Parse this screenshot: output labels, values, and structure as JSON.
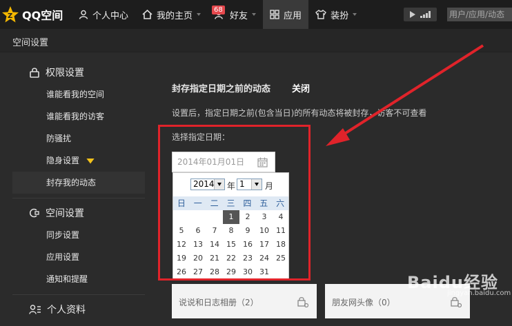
{
  "topbar": {
    "logo_text": "QQ空间",
    "nav": [
      "个人中心",
      "我的主页",
      "好友",
      "应用",
      "装扮"
    ],
    "badge": "68",
    "search_placeholder": "用户/应用/动态"
  },
  "subhead": {
    "title": "空间设置"
  },
  "sidebar": {
    "permission_header": "权限设置",
    "permission_items": [
      "谁能看我的空间",
      "谁能看我的访客",
      "防骚扰",
      "隐身设置",
      "封存我的动态"
    ],
    "space_header": "空间设置",
    "space_items": [
      "同步设置",
      "应用设置",
      "通知和提醒"
    ],
    "profile_header": "个人资料"
  },
  "main": {
    "title": "封存指定日期之前的动态",
    "toggle": "关闭",
    "description": "设置后，指定日期之前(包含当日)的所有动态将被封存，访客不可查看",
    "date_label": "选择指定日期：",
    "date_value": "2014年01月01日"
  },
  "calendar": {
    "year": "2014",
    "year_word": "年",
    "month": "1",
    "month_word": "月",
    "weekdays": [
      "日",
      "一",
      "二",
      "三",
      "四",
      "五",
      "六"
    ],
    "days": [
      "",
      "",
      "",
      "1",
      "2",
      "3",
      "4",
      "5",
      "6",
      "7",
      "8",
      "9",
      "10",
      "11",
      "12",
      "13",
      "14",
      "15",
      "16",
      "17",
      "18",
      "19",
      "20",
      "21",
      "22",
      "23",
      "24",
      "25",
      "26",
      "27",
      "28",
      "29",
      "30",
      "31"
    ],
    "selected_day": "1"
  },
  "cards": [
    "说说和日志相册（2）",
    "朋友网头像（0）"
  ],
  "watermark": {
    "big": "Baidu经验",
    "small": "jingyan.baidu.com"
  },
  "colors": {
    "annotation": "#e0232a",
    "vip_diamond": "#f3c21b"
  }
}
